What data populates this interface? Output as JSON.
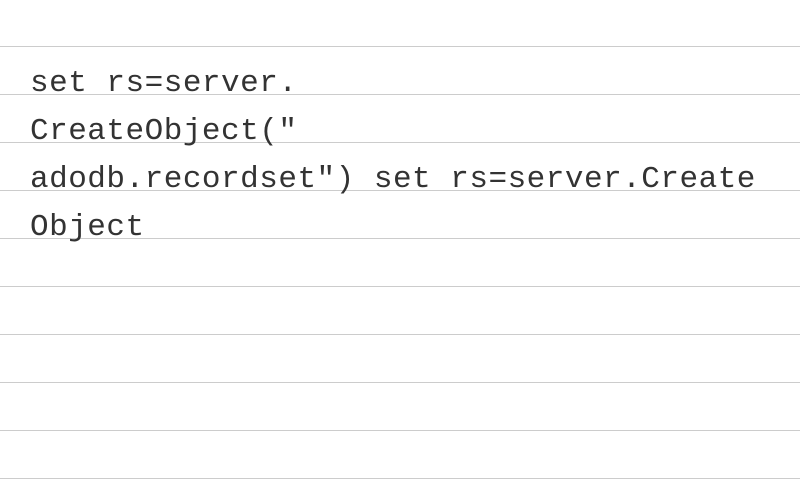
{
  "code": {
    "line1": "set rs=server.",
    "line2": "CreateObject(\"",
    "line3": "adodb.recordset\") set rs=server.CreateObject"
  },
  "lines": {
    "positions": [
      46,
      94,
      142,
      190,
      238,
      286,
      334,
      382,
      430,
      478
    ]
  }
}
